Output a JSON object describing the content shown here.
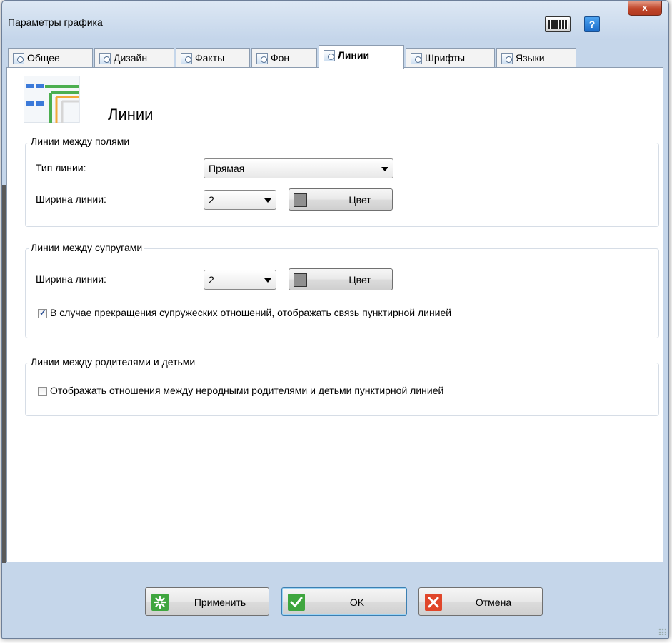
{
  "window": {
    "title": "Параметры графика"
  },
  "tabs": [
    {
      "label": "Общее"
    },
    {
      "label": "Дизайн"
    },
    {
      "label": "Факты"
    },
    {
      "label": "Фон"
    },
    {
      "label": "Линии"
    },
    {
      "label": "Шрифты"
    },
    {
      "label": "Языки"
    }
  ],
  "page": {
    "title": "Линии"
  },
  "group_fields": {
    "legend": "Линии между полями",
    "line_type_label": "Тип линии:",
    "line_type_value": "Прямая",
    "line_width_label": "Ширина линии:",
    "line_width_value": "2",
    "color_button": "Цвет"
  },
  "group_spouses": {
    "legend": "Линии между супругами",
    "line_width_label": "Ширина линии:",
    "line_width_value": "2",
    "color_button": "Цвет",
    "dashed_checkbox_label": "В случае прекращения супружеских отношений, отображать связь пунктирной линией",
    "dashed_checkbox_checked": true
  },
  "group_parents": {
    "legend": "Линии между родителями и детьми",
    "dashed_checkbox_label": "Отображать отношения между неродными родителями и детьми пунктирной линией",
    "dashed_checkbox_checked": false
  },
  "footer": {
    "apply": "Применить",
    "ok": "OK",
    "cancel": "Отмена"
  },
  "colors": {
    "line_swatch": "#8f8f8f",
    "apply_icon": "#3fa63f",
    "ok_icon": "#3fa63f",
    "cancel_icon": "#e0462a"
  }
}
